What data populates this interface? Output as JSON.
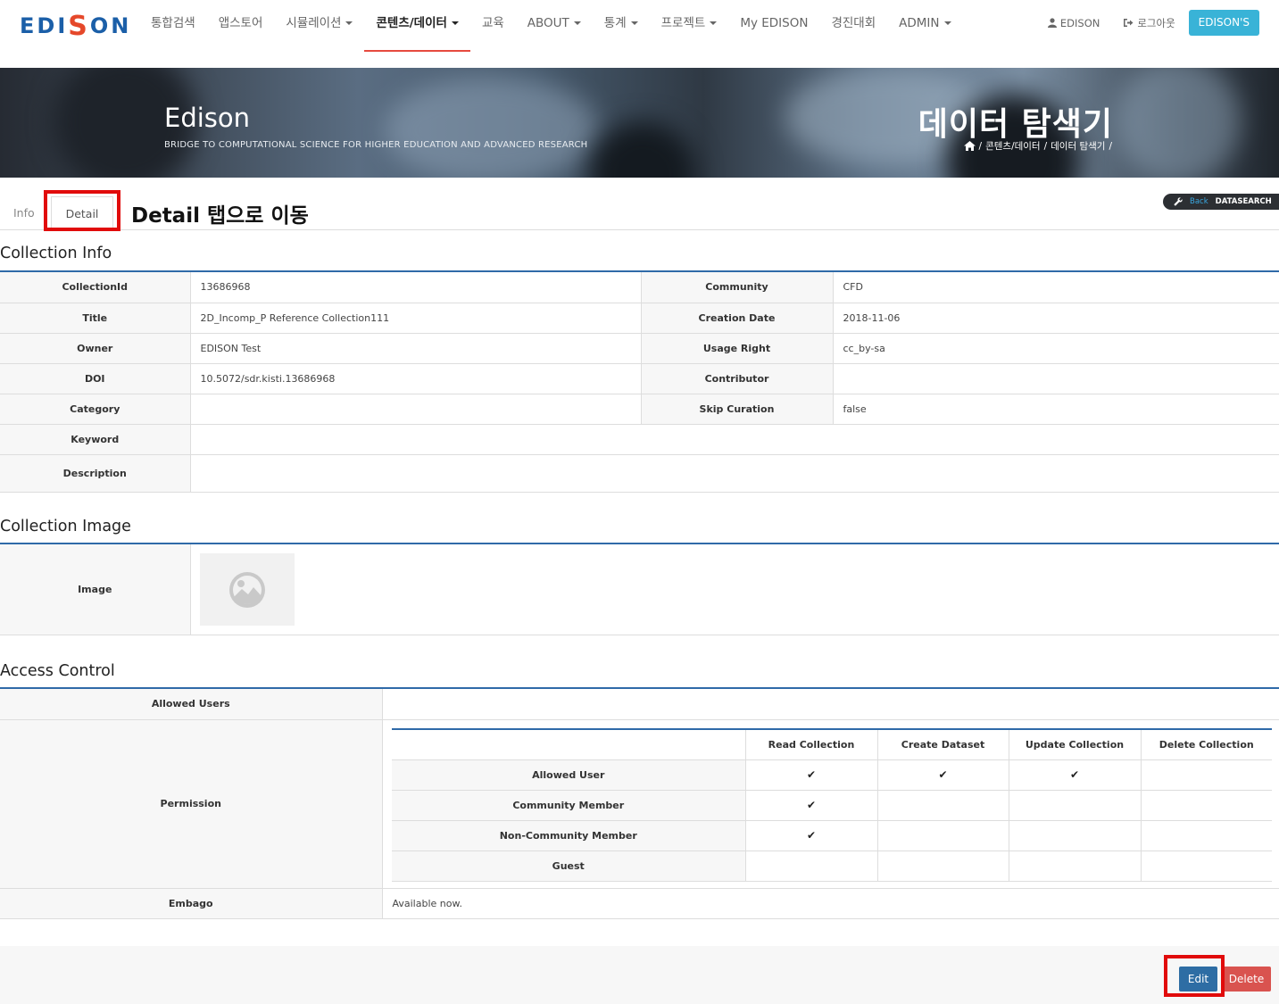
{
  "nav": {
    "logo_prefix": "EDI",
    "logo_s": "S",
    "logo_suffix": "ON",
    "items": [
      {
        "label": "통합검색",
        "dropdown": false
      },
      {
        "label": "앱스토어",
        "dropdown": false
      },
      {
        "label": "시뮬레이션",
        "dropdown": true
      },
      {
        "label": "콘텐츠/데이터",
        "dropdown": true,
        "active": true
      },
      {
        "label": "교육",
        "dropdown": false
      },
      {
        "label": "ABOUT",
        "dropdown": true
      },
      {
        "label": "통계",
        "dropdown": true
      },
      {
        "label": "프로젝트",
        "dropdown": true
      },
      {
        "label": "My EDISON",
        "dropdown": false
      },
      {
        "label": "경진대회",
        "dropdown": false
      },
      {
        "label": "ADMIN",
        "dropdown": true
      }
    ],
    "user_label": "EDISON",
    "logout_label": "로그아웃",
    "edisons_button": "EDISON'S"
  },
  "banner": {
    "title": "Edison",
    "subtitle": "BRIDGE TO COMPUTATIONAL SCIENCE FOR HIGHER EDUCATION AND ADVANCED RESEARCH",
    "heading": "데이터 탐색기",
    "breadcrumb": [
      "/",
      "콘텐츠/데이터",
      "/",
      "데이터 탐색기",
      "/"
    ]
  },
  "tabs": {
    "info": "Info",
    "detail": "Detail"
  },
  "annotation": "Detail 탭으로 이동",
  "badge": {
    "back": "Back",
    "datasearch": "DATASEARCH"
  },
  "collection_info": {
    "title": "Collection Info",
    "rows": [
      {
        "l1": "CollectionId",
        "v1": "13686968",
        "l2": "Community",
        "v2": "CFD"
      },
      {
        "l1": "Title",
        "v1": "2D_Incomp_P Reference Collection111",
        "l2": "Creation Date",
        "v2": "2018-11-06"
      },
      {
        "l1": "Owner",
        "v1": "EDISON Test",
        "l2": "Usage Right",
        "v2": "cc_by-sa"
      },
      {
        "l1": "DOI",
        "v1": "10.5072/sdr.kisti.13686968",
        "l2": "Contributor",
        "v2": ""
      },
      {
        "l1": "Category",
        "v1": "",
        "l2": "Skip Curation",
        "v2": "false"
      }
    ],
    "keyword_label": "Keyword",
    "keyword_value": "",
    "description_label": "Description",
    "description_value": ""
  },
  "collection_image": {
    "title": "Collection Image",
    "image_label": "Image"
  },
  "access_control": {
    "title": "Access Control",
    "allowed_users_label": "Allowed Users",
    "allowed_users_value": "",
    "permission_label": "Permission",
    "columns": [
      "Read Collection",
      "Create Dataset",
      "Update Collection",
      "Delete Collection"
    ],
    "rows": [
      {
        "label": "Allowed User",
        "checks": [
          true,
          true,
          true,
          false
        ]
      },
      {
        "label": "Community Member",
        "checks": [
          true,
          false,
          false,
          false
        ]
      },
      {
        "label": "Non-Community Member",
        "checks": [
          true,
          false,
          false,
          false
        ]
      },
      {
        "label": "Guest",
        "checks": [
          false,
          false,
          false,
          false
        ]
      }
    ],
    "check_glyph": "✔",
    "embargo_label": "Embago",
    "embargo_value": "Available now."
  },
  "actions": {
    "edit": "Edit",
    "delete": "Delete"
  }
}
